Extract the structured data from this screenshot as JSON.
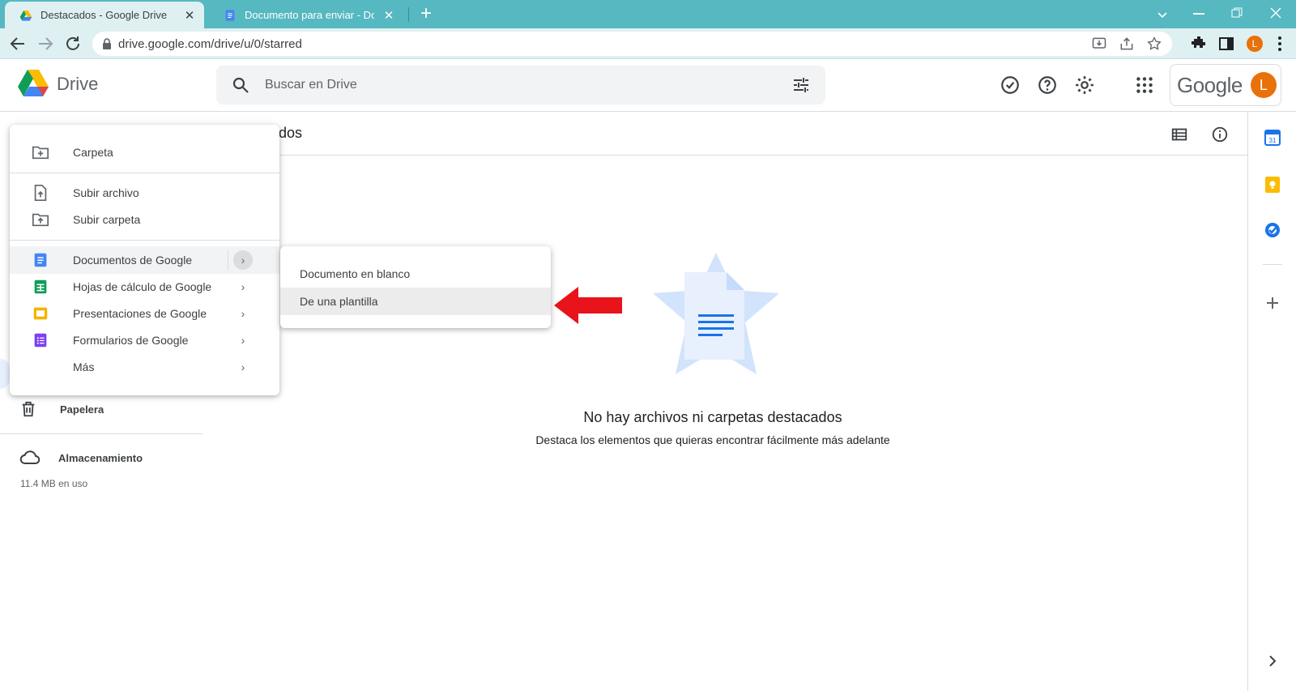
{
  "browser": {
    "tabs": [
      {
        "title": "Destacados - Google Drive",
        "active": true
      },
      {
        "title": "Documento para enviar - Docum",
        "active": false
      }
    ],
    "new_tab": "+",
    "url": "drive.google.com/drive/u/0/starred",
    "profile_initial": "L"
  },
  "drive": {
    "app_name": "Drive",
    "search_placeholder": "Buscar en Drive",
    "google_word": "Google",
    "account_initial": "L"
  },
  "main": {
    "page_title": "dos",
    "empty_title": "No hay archivos ni carpetas destacados",
    "empty_subtitle": "Destaca los elementos que quieras encontrar fácilmente más adelante"
  },
  "sidebar": {
    "trash": "Papelera",
    "storage": "Almacenamiento",
    "storage_used": "11.4 MB en uso"
  },
  "new_menu": {
    "items": [
      {
        "label": "Carpeta",
        "icon": "new-folder-icon"
      },
      {
        "label": "Subir archivo",
        "icon": "upload-file-icon"
      },
      {
        "label": "Subir carpeta",
        "icon": "upload-folder-icon"
      },
      {
        "label": "Documentos de Google",
        "icon": "google-docs-icon",
        "submenu": true,
        "highlighted": true
      },
      {
        "label": "Hojas de cálculo de Google",
        "icon": "google-sheets-icon",
        "submenu": true
      },
      {
        "label": "Presentaciones de Google",
        "icon": "google-slides-icon",
        "submenu": true
      },
      {
        "label": "Formularios de Google",
        "icon": "google-forms-icon",
        "submenu": true
      },
      {
        "label": "Más",
        "icon": "",
        "submenu": true
      }
    ]
  },
  "docs_submenu": {
    "items": [
      {
        "label": "Documento en blanco"
      },
      {
        "label": "De una plantilla",
        "highlighted": true
      }
    ]
  },
  "colors": {
    "tabbar": "#56b8c0",
    "toolbar": "#dff0f2",
    "accent_blue": "#1a73e8",
    "annotation_arrow": "#e8131b",
    "avatar": "#e8710a"
  }
}
